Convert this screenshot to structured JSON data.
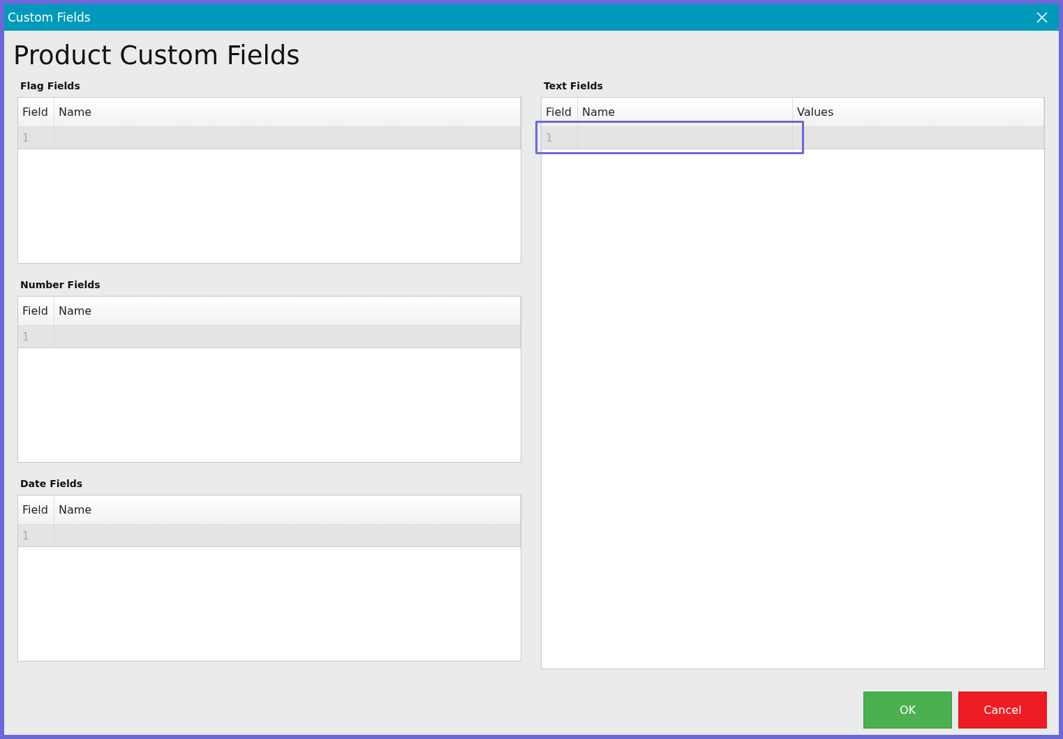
{
  "window": {
    "title": "Custom Fields"
  },
  "heading": "Product Custom Fields",
  "sections": [
    {
      "title": "Flag Fields",
      "columns": [
        "Field",
        "Name"
      ],
      "rows": [
        {
          "cells": [
            "1",
            ""
          ],
          "selected": true,
          "highlighted": false
        }
      ]
    },
    {
      "title": "Number Fields",
      "columns": [
        "Field",
        "Name"
      ],
      "rows": [
        {
          "cells": [
            "1",
            ""
          ],
          "selected": true,
          "highlighted": false
        }
      ]
    },
    {
      "title": "Date Fields",
      "columns": [
        "Field",
        "Name"
      ],
      "rows": [
        {
          "cells": [
            "1",
            ""
          ],
          "selected": true,
          "highlighted": false
        }
      ]
    },
    {
      "title": "Text Fields",
      "columns": [
        "Field",
        "Name",
        "Values"
      ],
      "rows": [
        {
          "cells": [
            "1",
            "",
            ""
          ],
          "selected": true,
          "highlighted": true
        }
      ]
    }
  ],
  "buttons": [
    {
      "label": "OK",
      "kind": "confirm"
    },
    {
      "label": "Cancel",
      "kind": "cancel"
    }
  ]
}
